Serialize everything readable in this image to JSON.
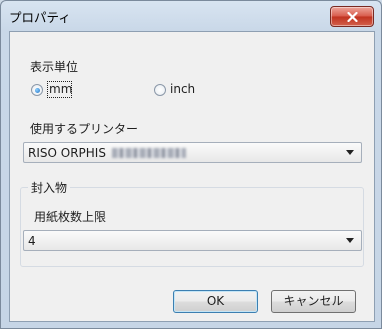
{
  "window": {
    "title": "プロパティ",
    "close_icon": "close-x-icon"
  },
  "units": {
    "label": "表示単位",
    "options": [
      {
        "label": "mm",
        "checked": true
      },
      {
        "label": "inch",
        "checked": false
      }
    ]
  },
  "printer": {
    "label": "使用するプリンター",
    "selected": "RISO ORPHIS"
  },
  "enclosure": {
    "group_label": "封入物",
    "paper_limit_label": "用紙枚数上限",
    "paper_limit_value": "4"
  },
  "buttons": {
    "ok": "OK",
    "cancel": "キャンセル"
  },
  "colors": {
    "close_button": "#c9412f",
    "window_frame": "#c6d5e6"
  }
}
